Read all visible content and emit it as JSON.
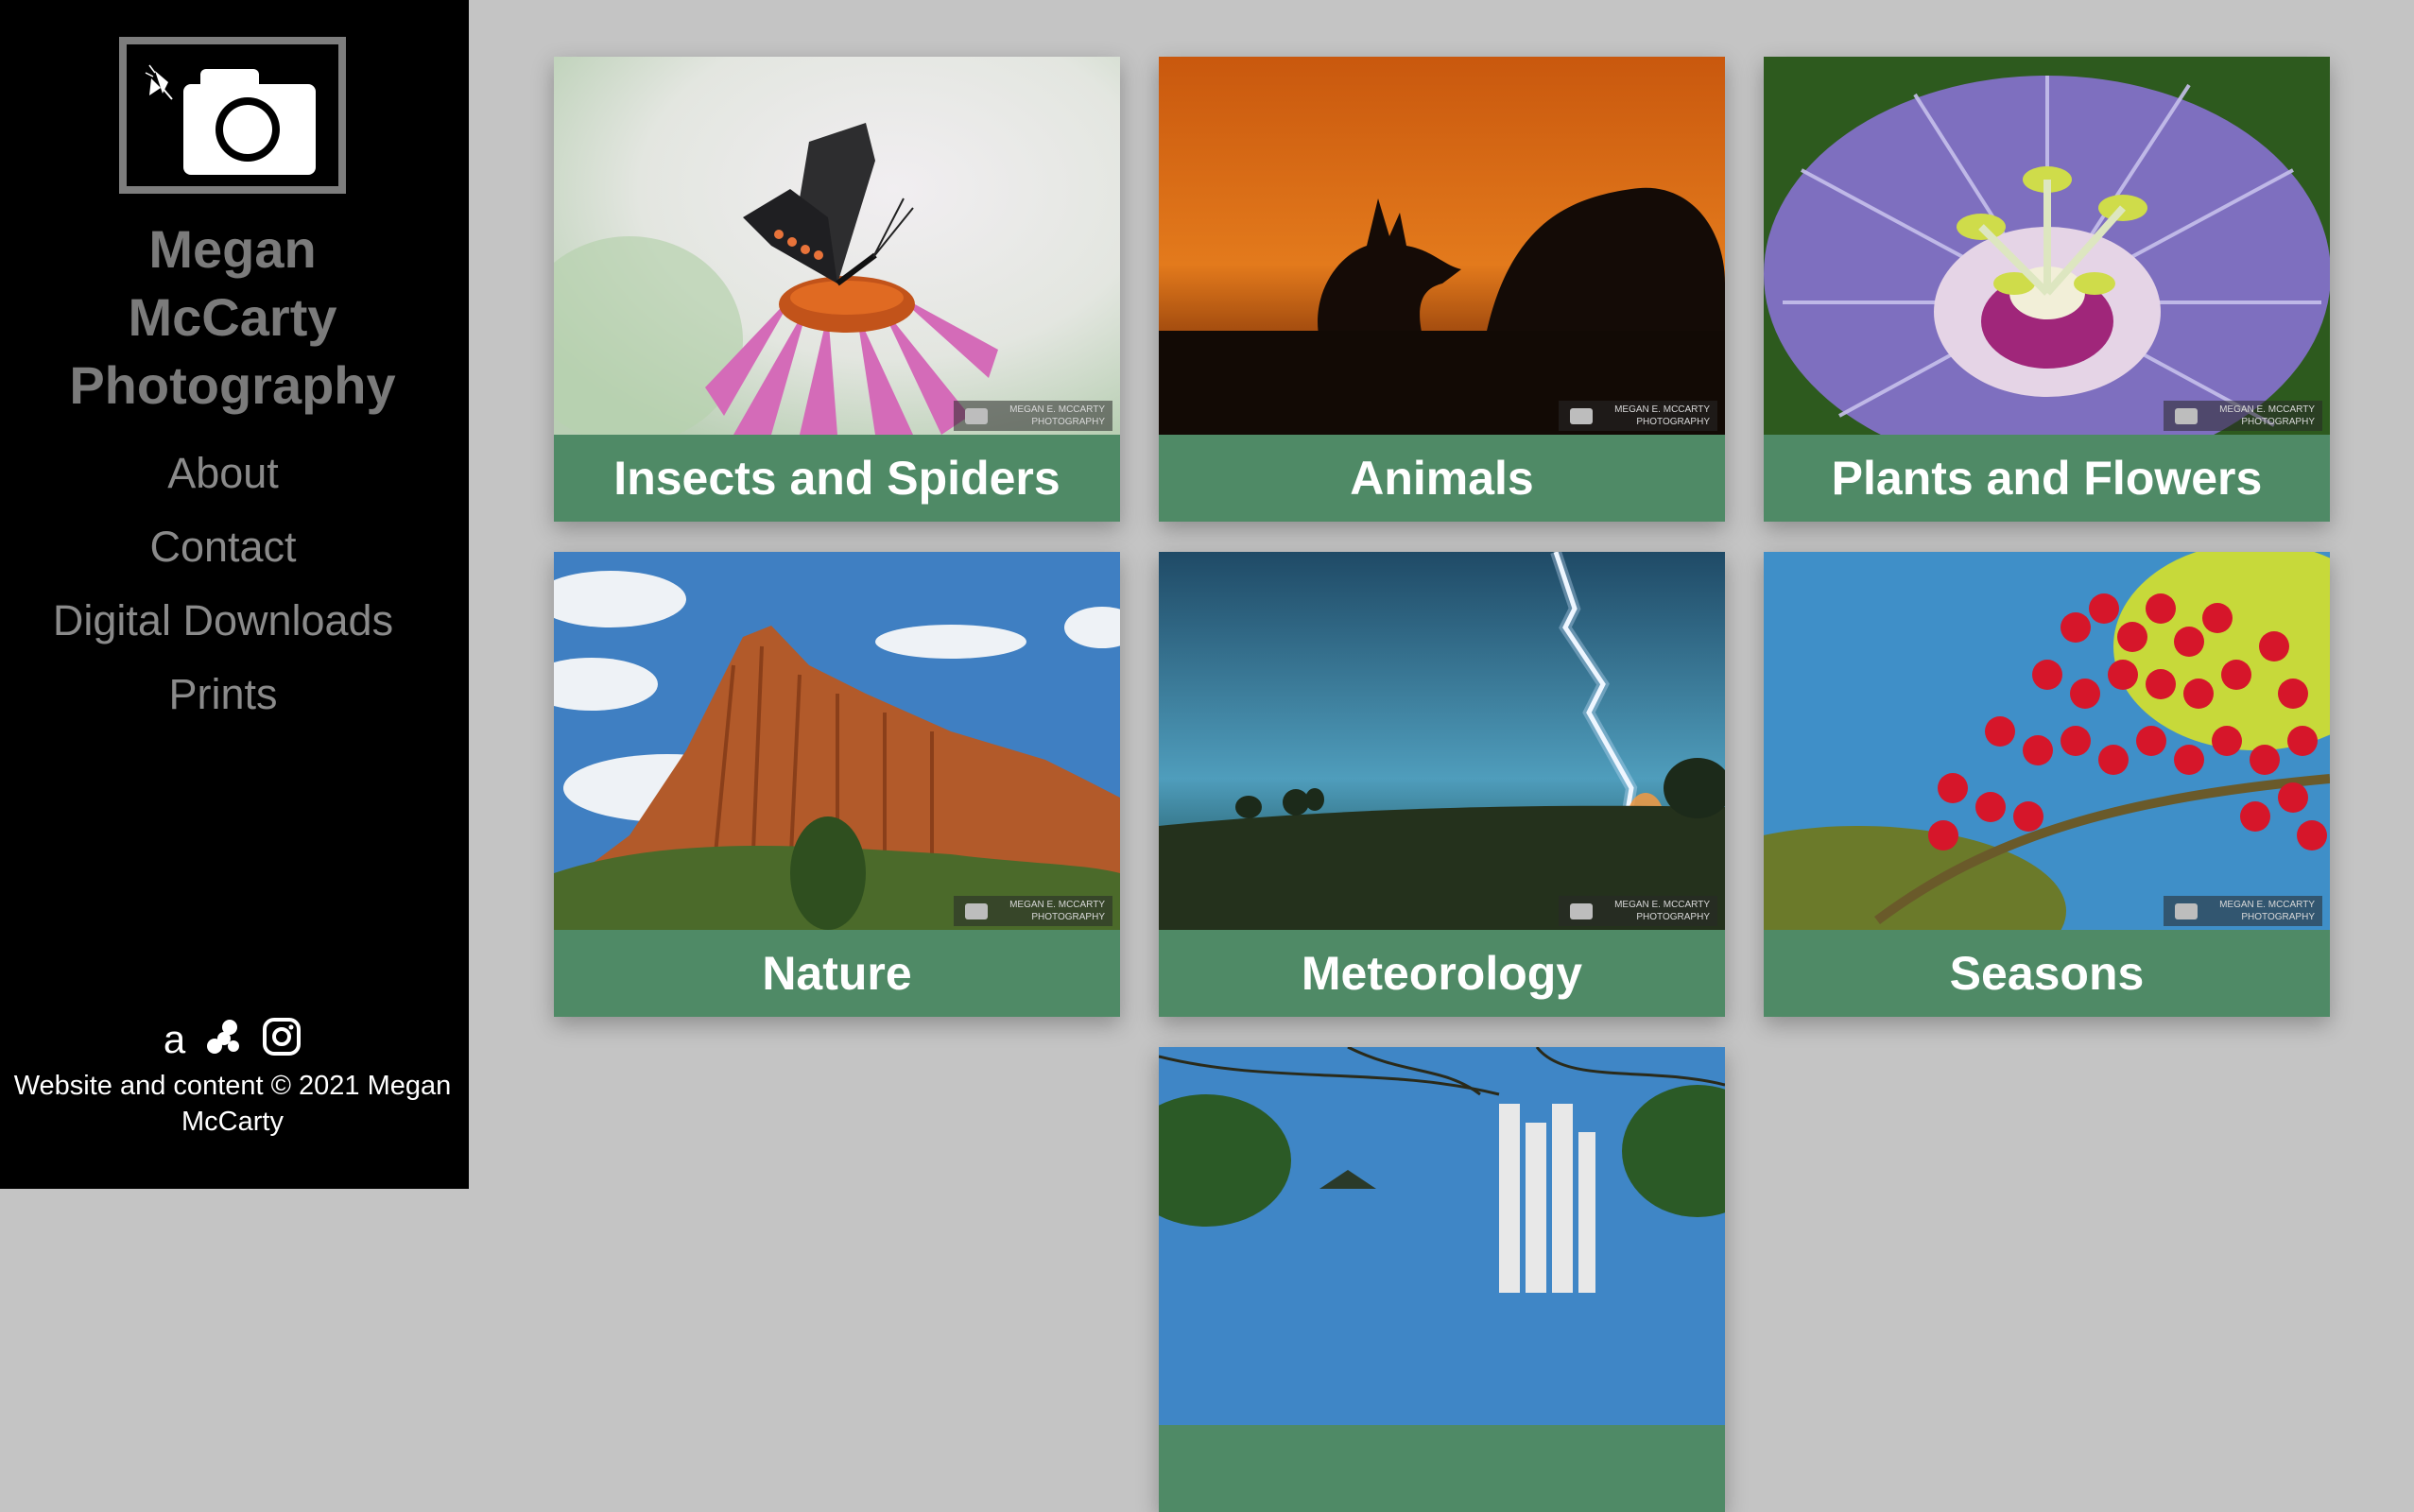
{
  "site": {
    "title_lines": [
      "Megan",
      "McCarty",
      "Photography"
    ]
  },
  "nav": {
    "items": [
      "About",
      "Contact",
      "Digital Downloads",
      "Prints"
    ]
  },
  "social": {
    "icons": [
      "amazon-icon",
      "pixel-icon",
      "instagram-icon"
    ],
    "amazon_glyph": "a"
  },
  "footer": {
    "copyright_line1": "Website and content © 2021 Megan",
    "copyright_line2": "McCarty"
  },
  "galleries": [
    {
      "label": "Insects and Spiders",
      "watermark": [
        "MEGAN E. MCCARTY",
        "PHOTOGRAPHY"
      ]
    },
    {
      "label": "Animals",
      "watermark": [
        "MEGAN E. MCCARTY",
        "PHOTOGRAPHY"
      ]
    },
    {
      "label": "Plants and Flowers",
      "watermark": [
        "MEGAN E. MCCARTY",
        "PHOTOGRAPHY"
      ]
    },
    {
      "label": "Nature",
      "watermark": [
        "MEGAN E. MCCARTY",
        "PHOTOGRAPHY"
      ]
    },
    {
      "label": "Meteorology",
      "watermark": [
        "MEGAN E. MCCARTY",
        "PHOTOGRAPHY"
      ]
    },
    {
      "label": "Seasons",
      "watermark": [
        "MEGAN E. MCCARTY",
        "PHOTOGRAPHY"
      ]
    },
    {
      "label": "",
      "watermark": []
    }
  ],
  "colors": {
    "sidebar_bg": "#000000",
    "page_bg": "#c4c4c4",
    "label_bar": "#4f8a66",
    "nav_text": "#8a8a8a",
    "title_text": "#7b7b7b"
  }
}
